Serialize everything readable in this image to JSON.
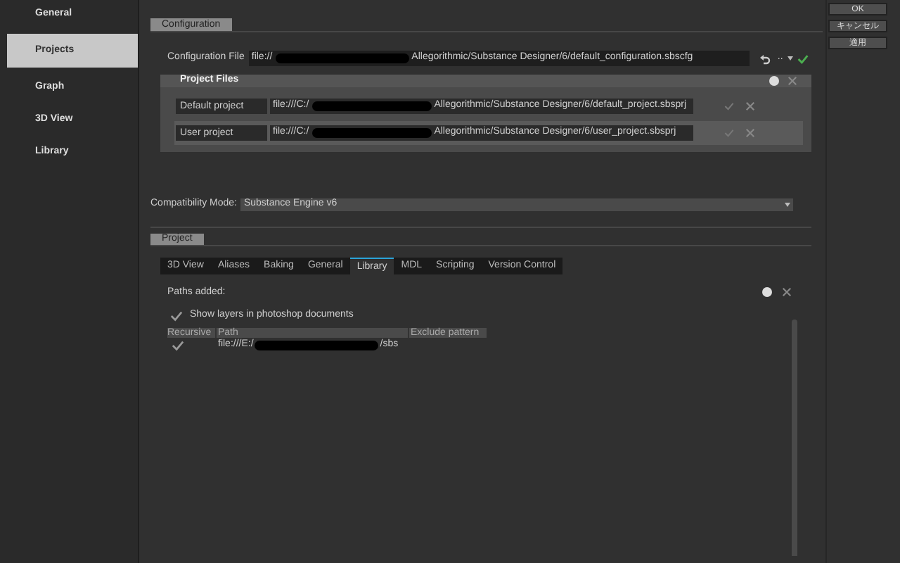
{
  "sidebar": {
    "items": [
      {
        "label": "General",
        "selected": false
      },
      {
        "label": "Projects",
        "selected": true
      },
      {
        "label": "Graph",
        "selected": false
      },
      {
        "label": "3D View",
        "selected": false
      },
      {
        "label": "Library",
        "selected": false
      }
    ]
  },
  "configuration": {
    "header": "Configuration",
    "label": "Configuration File",
    "path_start": "file://",
    "path_end": "Allegorithmic/Substance Designer/6/default_configuration.sbscfg",
    "more": ".."
  },
  "project_files": {
    "title": "Project Files",
    "rows": [
      {
        "label": "Default project",
        "path_start": "file:///C:/",
        "path_end": "Allegorithmic/Substance Designer/6/default_project.sbsprj",
        "selected": false
      },
      {
        "label": "User project",
        "path_start": "file:///C:/",
        "path_end": "Allegorithmic/Substance Designer/6/user_project.sbsprj",
        "selected": true
      }
    ]
  },
  "compatibility": {
    "label": "Compatibility Mode:",
    "value": "Substance Engine v6"
  },
  "project": {
    "header": "Project",
    "tabs": [
      {
        "label": "3D View",
        "selected": false
      },
      {
        "label": "Aliases",
        "selected": false
      },
      {
        "label": "Baking",
        "selected": false
      },
      {
        "label": "General",
        "selected": false
      },
      {
        "label": "Library",
        "selected": true
      },
      {
        "label": "MDL",
        "selected": false
      },
      {
        "label": "Scripting",
        "selected": false
      },
      {
        "label": "Version Control",
        "selected": false
      }
    ],
    "paths_label": "Paths added:",
    "show_layers": {
      "label": "Show layers in photoshop documents",
      "checked": true
    },
    "table": {
      "columns": [
        "Recursive",
        "Path",
        "Exclude pattern"
      ],
      "rows": [
        {
          "recursive": true,
          "path_start": "file:///E:/",
          "path_end": "/sbs"
        }
      ]
    }
  },
  "buttons": [
    "OK",
    "キャンセル",
    "適用"
  ]
}
